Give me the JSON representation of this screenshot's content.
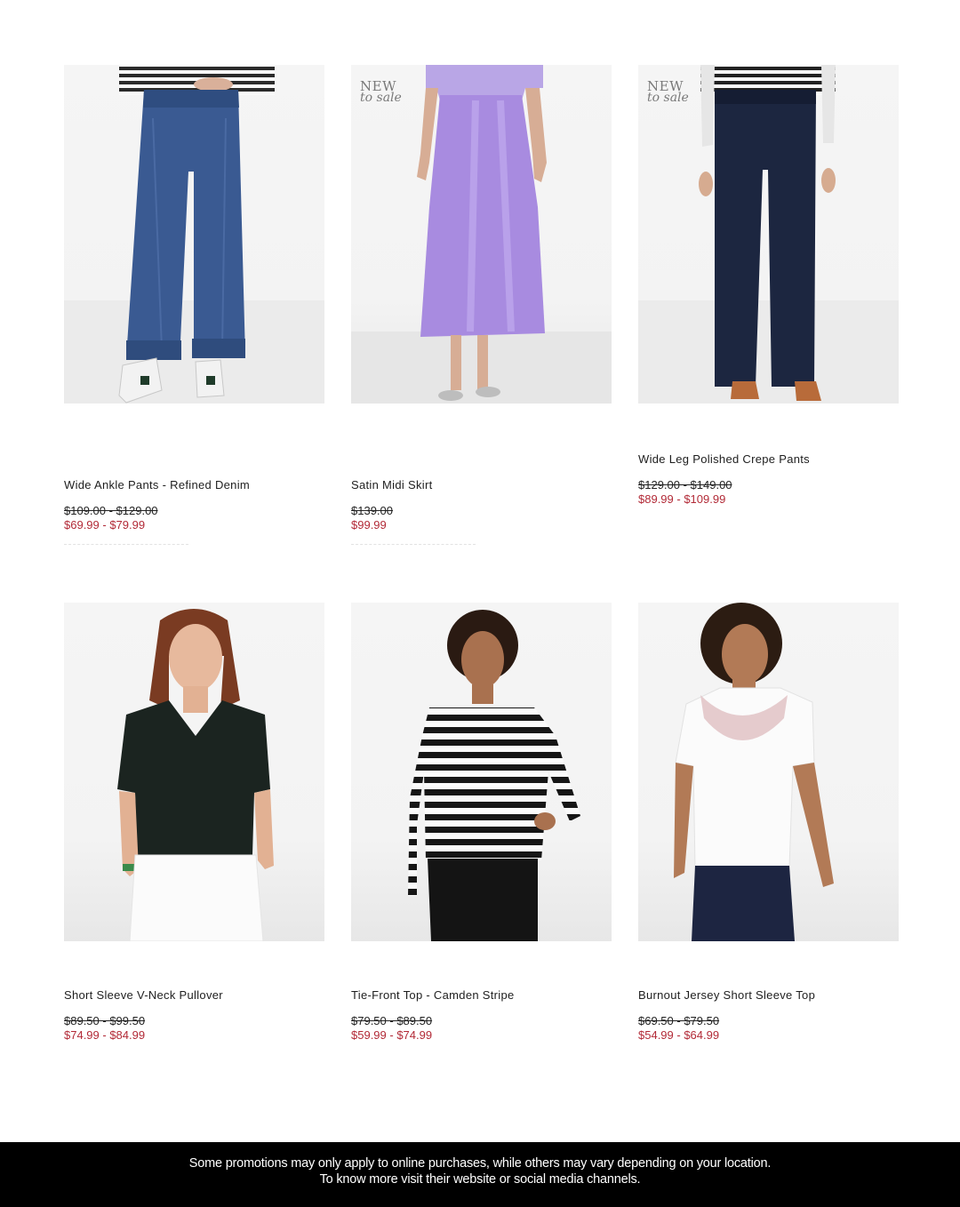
{
  "badge": {
    "line1": "NEW",
    "line2": "to sale"
  },
  "products": [
    {
      "name": "Wide Ankle Pants - Refined Denim",
      "was": "$109.00 - $129.00",
      "now": "$69.99 - $79.99",
      "badge": false
    },
    {
      "name": "Satin Midi Skirt",
      "was": "$139.00",
      "now": "$99.99",
      "badge": true
    },
    {
      "name": "Wide Leg Polished Crepe Pants",
      "was": "$129.00 - $149.00",
      "now": "$89.99 - $109.99",
      "badge": true
    },
    {
      "name": "Short Sleeve V-Neck Pullover",
      "was": "$89.50 - $99.50",
      "now": "$74.99 - $84.99",
      "badge": false
    },
    {
      "name": "Tie-Front Top - Camden Stripe",
      "was": "$79.50 - $89.50",
      "now": "$59.99 - $74.99",
      "badge": false
    },
    {
      "name": "Burnout Jersey Short Sleeve Top",
      "was": "$69.50 - $79.50",
      "now": "$54.99 - $64.99",
      "badge": false
    }
  ],
  "footer": {
    "line1": "Some promotions may only apply to online purchases, while others may vary depending on your location.",
    "line2": "To know more visit their website or social media channels."
  },
  "colors": {
    "sale_price": "#b22a37",
    "footer_bg": "#000000",
    "text": "#1e1e1e"
  }
}
